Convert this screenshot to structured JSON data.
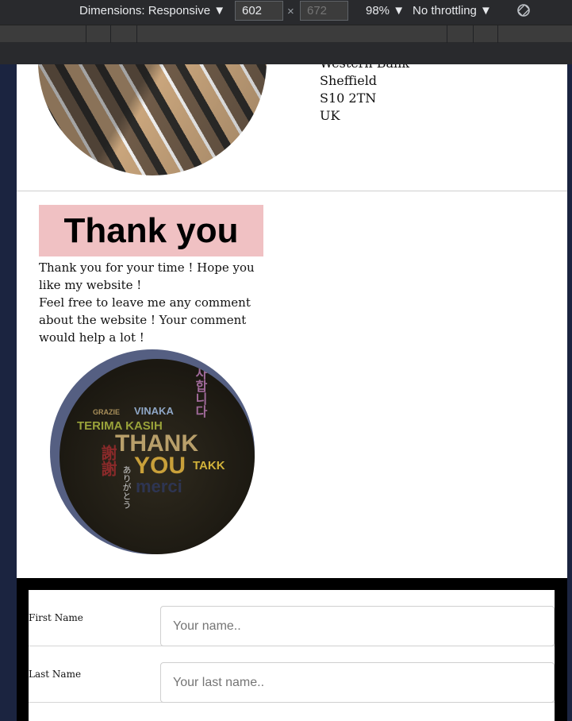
{
  "devtools": {
    "dimensions_label": "Dimensions: Responsive ▼",
    "width_value": "602",
    "times": "×",
    "height_placeholder": "672",
    "zoom": "98% ▼",
    "throttling": "No throttling ▼",
    "rotate_icon": "rotate-icon"
  },
  "address": {
    "line1": "Western Bank",
    "line2": "Sheffield",
    "line3": "S10 2TN",
    "line4": "UK"
  },
  "thanks": {
    "heading": "Thank you",
    "para1": "Thank you for your time ! Hope you like my website !",
    "para2": "Feel free to leave me any comment about the website ! Your comment would help a lot !"
  },
  "thank_image": {
    "words": [
      "GRAZIE",
      "VINAKA",
      "TERIMA KASIH",
      "THANK",
      "YOU",
      "TAKK",
      "merci",
      "사합니다",
      "謝謝",
      "ありがとう"
    ]
  },
  "form": {
    "first_label": "First Name",
    "first_placeholder": "Your name..",
    "last_label": "Last Name",
    "last_placeholder": "Your last name.."
  }
}
